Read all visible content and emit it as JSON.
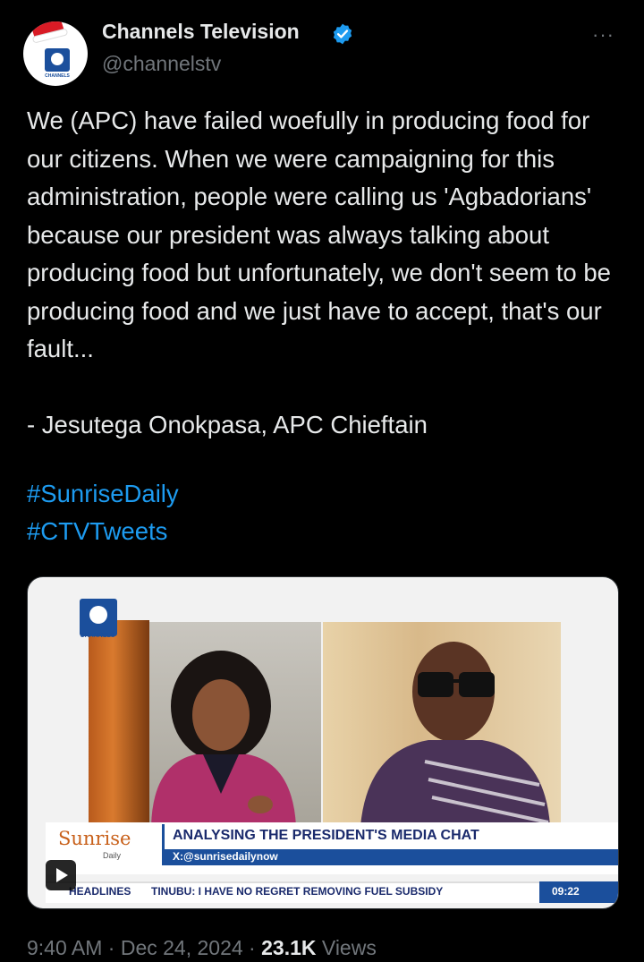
{
  "account": {
    "display_name": "Channels Television",
    "handle": "@channelstv",
    "avatar_text": "CHANNELS",
    "verified_color": "#1d9bf0"
  },
  "more_menu": "···",
  "tweet": {
    "text": "We (APC) have failed woefully in producing food for our citizens. When we were campaigning for this administration, people were calling us 'Agbadorians' because our president was always talking about producing food but unfortunately, we don't seem to be producing food and we just have to accept, that's our fault...\n\n- Jesutega Onokpasa, APC Chieftain",
    "hashtags": [
      "#SunriseDaily",
      "#CTVTweets"
    ]
  },
  "video": {
    "channel_logo_label": "CHANNELS",
    "show_name": "Sunrise",
    "show_sub": "Daily",
    "headline": "ANALYSING THE PRESIDENT'S MEDIA CHAT",
    "social_handle": "X:@sunrisedailynow",
    "ticker_label": "HEADLINES",
    "ticker_text": "TINUBU: I HAVE NO REGRET REMOVING FUEL SUBSIDY",
    "ticker_time": "09:22"
  },
  "meta": {
    "time": "9:40 AM",
    "sep1": " · ",
    "date": "Dec 24, 2024",
    "sep2": " · ",
    "views_count": "23.1K",
    "views_label": " Views"
  },
  "colors": {
    "background": "#000000",
    "text": "#e7e9ea",
    "muted": "#71767b",
    "link": "#1d9bf0"
  }
}
